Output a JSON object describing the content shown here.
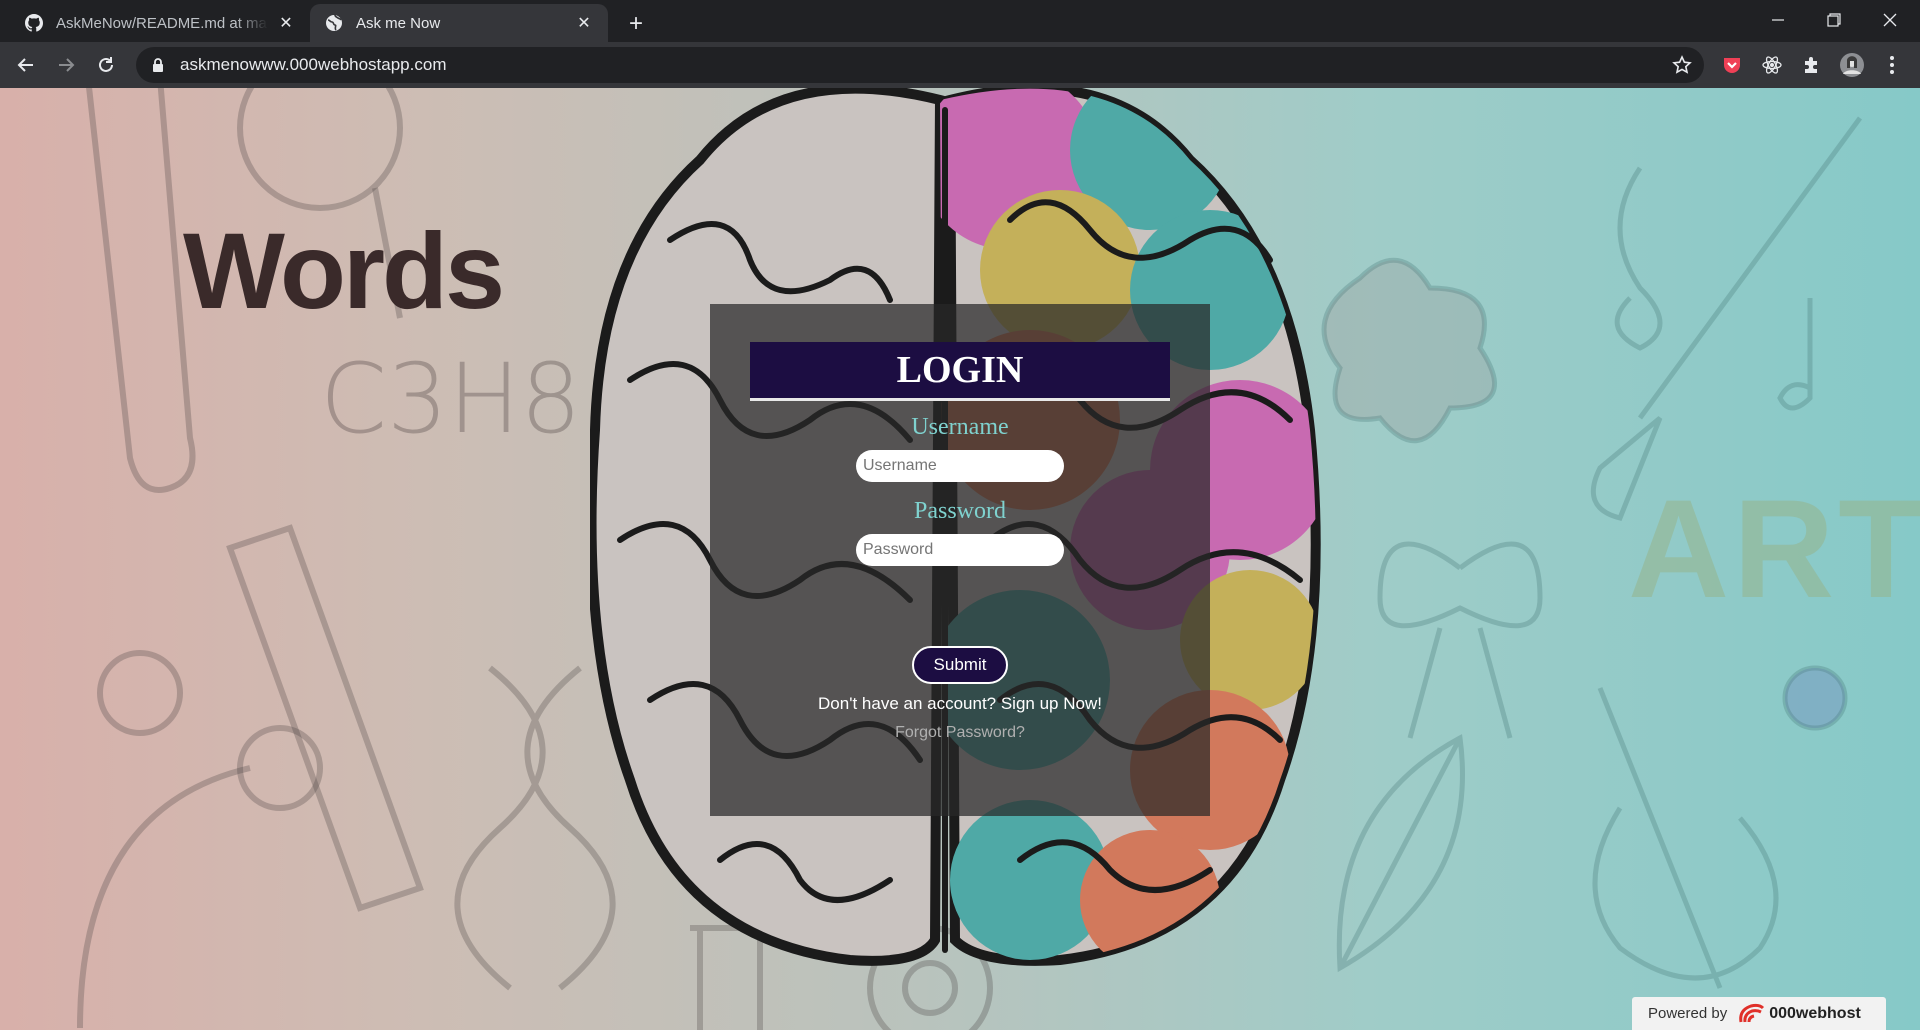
{
  "browser": {
    "tabs": [
      {
        "title": "AskMeNow/README.md at master",
        "favicon": "github-icon",
        "active": false
      },
      {
        "title": "Ask me Now",
        "favicon": "globe-icon",
        "active": true
      }
    ],
    "url": "askmenowww.000webhostapp.com",
    "new_tab_symbol": "+"
  },
  "background": {
    "words_label": "Words",
    "art_label": "ART",
    "formula": "C3H8",
    "colors": {
      "left": "#d8b0aa",
      "right": "#86c9c8"
    }
  },
  "login": {
    "title": "LOGIN",
    "username_label": "Username",
    "username_placeholder": "Username",
    "username_value": "",
    "password_label": "Password",
    "password_placeholder": "Password",
    "password_value": "",
    "submit_label": "Submit",
    "signup_text": "Don't have an account? Sign up Now!",
    "forgot_text": "Forgot Password?",
    "colors": {
      "title_bg": "#1c0d42",
      "label": "#7fd2cf"
    }
  },
  "footer": {
    "powered_label": "Powered by",
    "brand": "000webhost"
  }
}
